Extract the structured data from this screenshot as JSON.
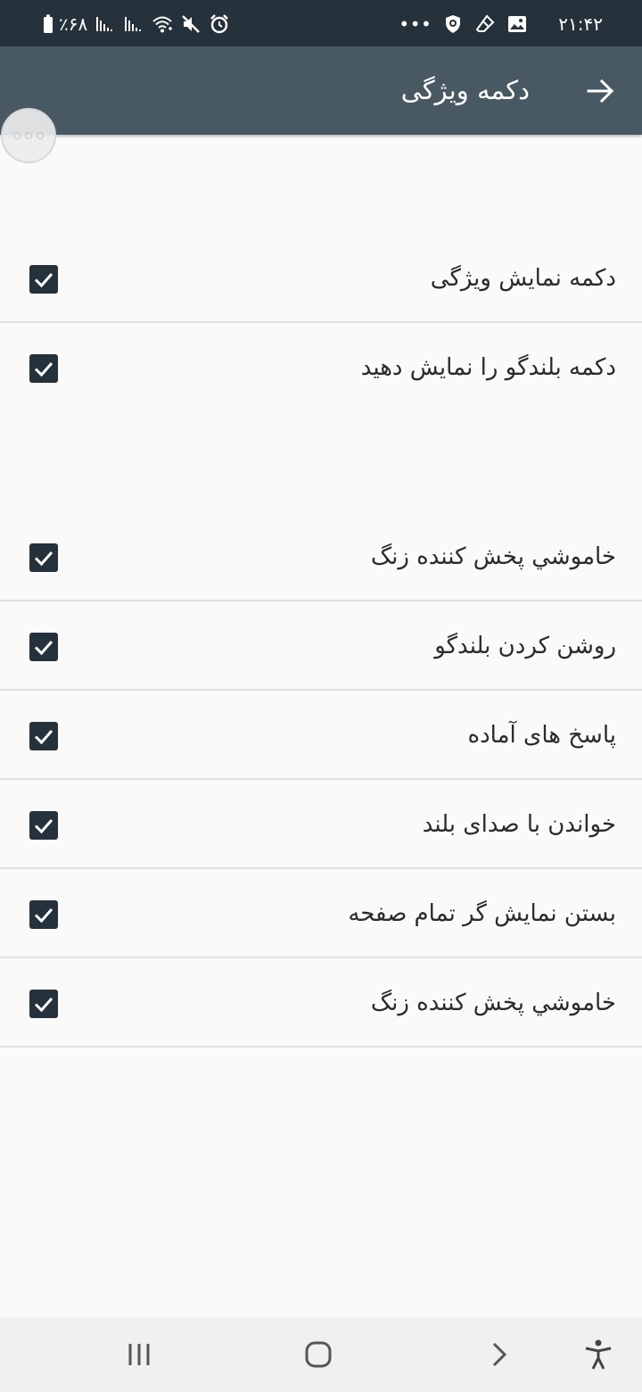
{
  "status_bar": {
    "time": "۲۱:۴۲",
    "battery": "٪۶۸",
    "dots": "•••",
    "icons_left": [
      "battery-icon",
      "signal-icon",
      "signal-icon",
      "wifi-icon",
      "mute-icon",
      "alarm-icon"
    ],
    "icons_right": [
      "shield-icon",
      "eraser-icon",
      "image-icon"
    ]
  },
  "app_bar": {
    "title": "دکمه ویژگی",
    "back_icon": "arrow-right-icon"
  },
  "settings": {
    "items": [
      {
        "label": "دکمه نمایش ویژگی",
        "checked": true
      },
      {
        "label": "دکمه بلندگو را نمایش دهید",
        "checked": true
      },
      {
        "label": "خاموشي پخش کننده زنگ",
        "checked": true
      },
      {
        "label": "روشن کردن بلندگو",
        "checked": true
      },
      {
        "label": "پاسخ های آماده",
        "checked": true
      },
      {
        "label": "خواندن با صدای بلند",
        "checked": true
      },
      {
        "label": "بستن نمایش گر تمام صفحه",
        "checked": true
      },
      {
        "label": "خاموشي پخش کننده زنگ",
        "checked": true
      }
    ]
  },
  "nav_bar": {
    "buttons": [
      "recents-icon",
      "home-icon",
      "back-chevron-icon",
      "accessibility-icon"
    ]
  },
  "colors": {
    "status_bar": "#25313b",
    "app_bar": "#485963",
    "checkbox": "#25313b",
    "background": "#fafafa"
  }
}
